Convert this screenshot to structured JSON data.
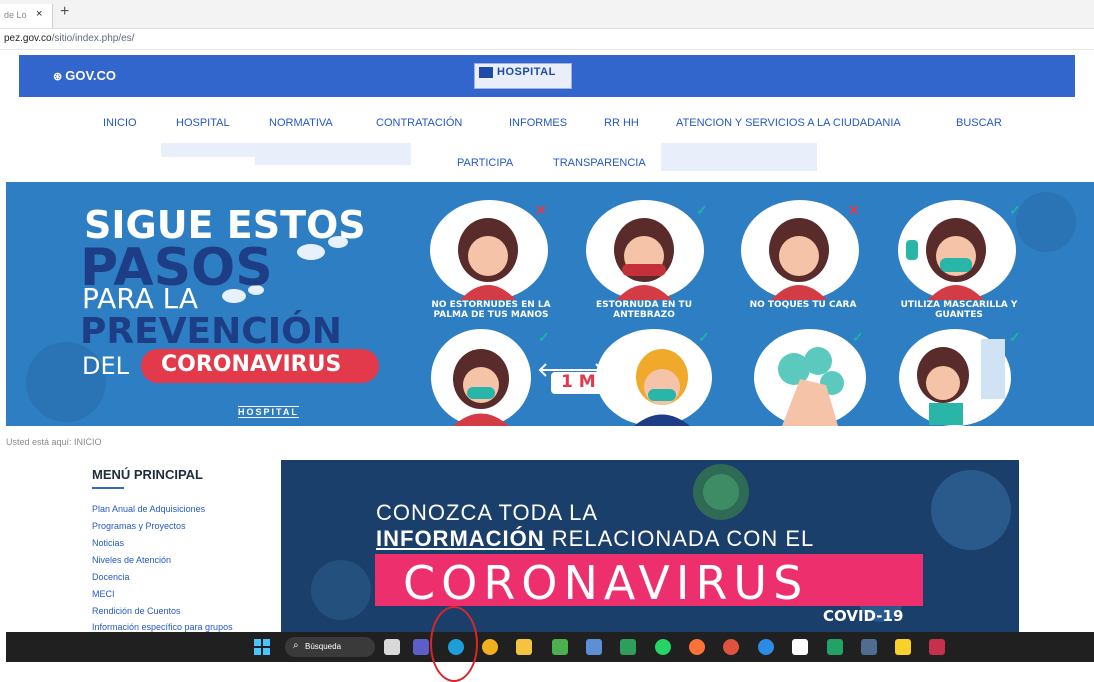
{
  "browser": {
    "tab_title": "de Lo",
    "tab_close": "×",
    "new_tab": "+",
    "url_host": "pez.gov.co",
    "url_path": "/sitio/index.php/es/"
  },
  "gov_bar": {
    "logo_text": "GOV.CO",
    "hospital_logo_text": "HOSPITAL"
  },
  "nav": {
    "items": [
      "INICIO",
      "HOSPITAL",
      "NORMATIVA",
      "CONTRATACIÓN",
      "INFORMES",
      "RR HH",
      "ATENCION Y SERVICIOS A LA CIUDADANIA",
      "BUSCAR"
    ],
    "row2": [
      "PARTICIPA",
      "TRANSPARENCIA"
    ]
  },
  "banner": {
    "line1": "SIGUE ESTOS",
    "line2": "PASOS",
    "line3": "PARA LA",
    "line4": "PREVENCIÓN",
    "line5": "DEL",
    "pill": "CORONAVIRUS",
    "steps": [
      {
        "label": "NO ESTORNUDES EN LA PALMA DE TUS MANOS",
        "mark": "✕",
        "ok": false
      },
      {
        "label": "ESTORNUDA EN TU ANTEBRAZO",
        "mark": "✓",
        "ok": true
      },
      {
        "label": "NO TOQUES TU CARA",
        "mark": "✕",
        "ok": false
      },
      {
        "label": "UTILIZA MASCARILLA Y GUANTES",
        "mark": "✓",
        "ok": true
      }
    ],
    "distance": "1 M",
    "hospital_text": "HOSPITAL",
    "colors": {
      "bg": "#2d7ec2",
      "navy": "#1d3e87",
      "red": "#e23a4a",
      "teal": "#1fb3a6"
    }
  },
  "breadcrumb": "Usted está aquí: INICIO",
  "sidebar": {
    "title": "MENÚ PRINCIPAL",
    "links": [
      "Plan Anual de Adquisiciones",
      "Programas y Proyectos",
      "Noticias",
      "Niveles de Atención",
      "Docencia",
      "MECI",
      "Rendición de Cuentos",
      "Información específico para grupos"
    ]
  },
  "banner2": {
    "line1": "CONOZCA TODA LA",
    "line2_bold": "INFORMACIÓN",
    "line2_rest": " RELACIONADA CON EL",
    "headline": "CORONAVIRUS",
    "tag": "COVID-19"
  },
  "taskbar": {
    "search_label": "Búsqueda",
    "icons": [
      "windows-start-icon",
      "file-explorer-icon",
      "teams-icon",
      "edge-icon",
      "chrome-icon",
      "folder-icon",
      "app-icon",
      "app-icon-2",
      "media-icon",
      "whatsapp-icon",
      "firefox-icon",
      "app-icon-3",
      "app-icon-4",
      "chart-app-icon",
      "excel-icon",
      "sheets-icon",
      "sticky-notes-icon",
      "app-icon-5"
    ]
  }
}
